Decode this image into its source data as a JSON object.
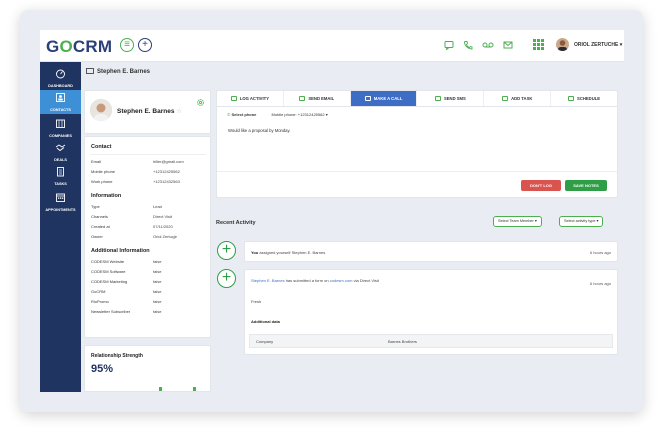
{
  "app": {
    "logo_g": "G",
    "logo_o": "O",
    "logo_crm": "CRM",
    "user_name": "ORIOL ZERTUCHE ▾"
  },
  "sidebar": {
    "items": [
      {
        "label": "DASHBOARD",
        "icon": "dashboard-icon"
      },
      {
        "label": "CONTACTS",
        "icon": "contacts-icon",
        "active": true
      },
      {
        "label": "COMPANIES",
        "icon": "companies-icon"
      },
      {
        "label": "DEALS",
        "icon": "deals-icon"
      },
      {
        "label": "TASKS",
        "icon": "tasks-icon"
      },
      {
        "label": "APPOINTMENTS",
        "icon": "appointments-icon"
      }
    ]
  },
  "breadcrumb": "Stephen E. Barnes",
  "profile": {
    "name": "Stephen E. Barnes"
  },
  "contact": {
    "title": "Contact",
    "rows": [
      {
        "label": "Email",
        "value": "hiller@gmail.com"
      },
      {
        "label": "Mobile phone",
        "value": "+12312425562"
      },
      {
        "label": "Work phone",
        "value": "+12312432563"
      }
    ]
  },
  "information": {
    "title": "Information",
    "rows": [
      {
        "label": "Type",
        "value": "Lead"
      },
      {
        "label": "Channels",
        "value": "Direct Visit"
      },
      {
        "label": "Created at",
        "value": "07/11/2020"
      },
      {
        "label": "Owner",
        "value": "Oriol Zertuçje"
      }
    ]
  },
  "additional": {
    "title": "Additional Information",
    "rows": [
      {
        "label": "CODESM Website",
        "value": "false"
      },
      {
        "label": "CODESM Software",
        "value": "false"
      },
      {
        "label": "CODESM Marketing",
        "value": "false"
      },
      {
        "label": "GoCRM",
        "value": "false"
      },
      {
        "label": "RioPromo",
        "value": "false"
      },
      {
        "label": "Newsletter Subscriber",
        "value": "false"
      }
    ]
  },
  "relationship": {
    "title": "Relationship Strength",
    "value": "95%",
    "level": 0.95
  },
  "compose": {
    "tabs": [
      {
        "label": "LOG ACTIVITY"
      },
      {
        "label": "SEND EMAIL"
      },
      {
        "label": "MAKE A CALL",
        "active": true
      },
      {
        "label": "SEND SMS"
      },
      {
        "label": "ADD TASK"
      },
      {
        "label": "SCHEDULE"
      }
    ],
    "select_phone_label": "Select phone",
    "phone_value": "Mobile phone: +12312425562",
    "note": "Would like a proposal by Monday.",
    "dont_log_label": "DON'T LOG",
    "save_label": "SAVE NOTES"
  },
  "recent": {
    "title": "Recent Activity",
    "filter_member": "Select Team Member ▾",
    "filter_type": "Select activity type ▾",
    "activity1": {
      "you": "You",
      "text": "assigned yourself Stephen E. Barnes",
      "time": "6 hours ago"
    },
    "activity2": {
      "who": "Stephen E. Barnes",
      "mid": "has submitted a form on",
      "site": "codesm.com",
      "end": "via Direct Visit",
      "time": "6 hours ago",
      "status": "Fresh",
      "section": "Additional data",
      "field_label": "Company",
      "field_value": "Barnes Brothers"
    }
  }
}
